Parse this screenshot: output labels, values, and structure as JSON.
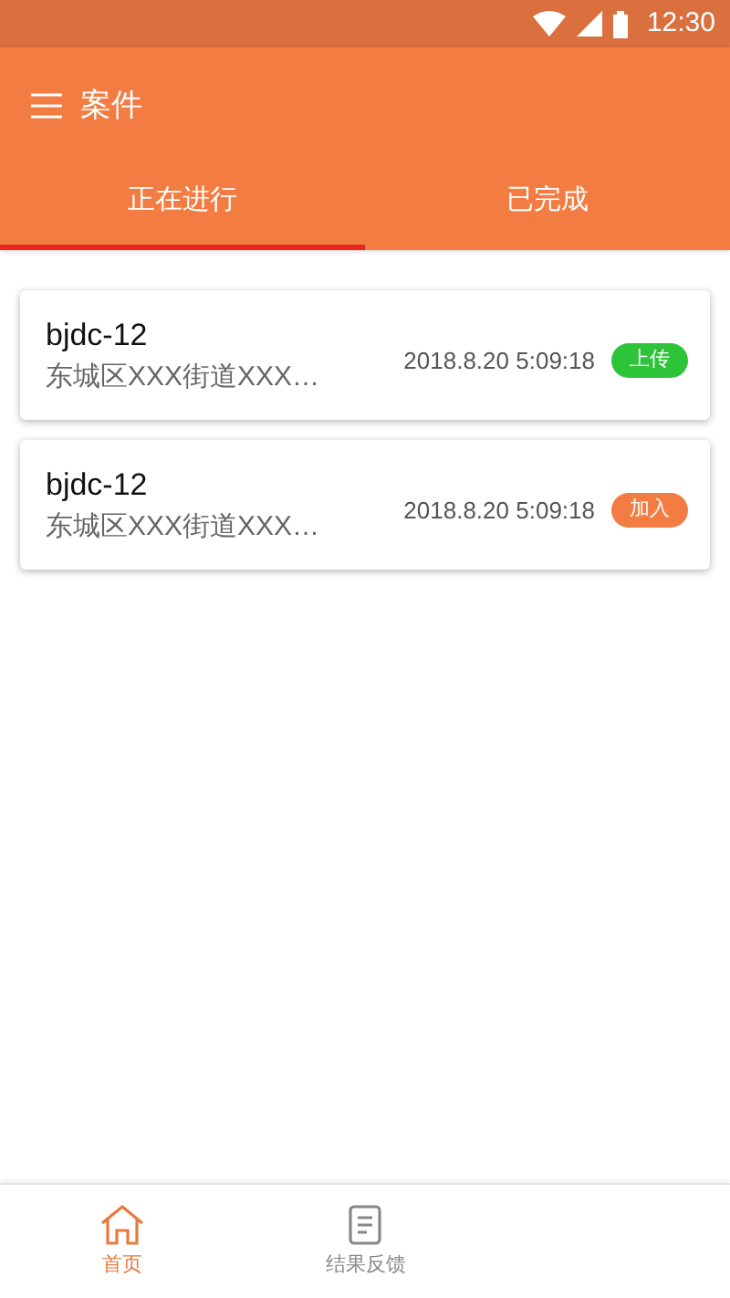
{
  "status_bar": {
    "time": "12:30"
  },
  "app_bar": {
    "title": "案件"
  },
  "tabs": [
    {
      "label": "正在进行",
      "selected": true
    },
    {
      "label": "已完成",
      "selected": false
    }
  ],
  "cases": [
    {
      "name": "bjdc-12",
      "address": "东城区XXX街道XXX…",
      "time": "2018.8.20 5:09:18",
      "action": "上传",
      "color": "#2ec43a"
    },
    {
      "name": "bjdc-12",
      "address": "东城区XXX街道XXX…",
      "time": "2018.8.20 5:09:18",
      "action": "加入",
      "color": "#f27c41"
    }
  ],
  "bottom_nav": [
    {
      "label": "首页",
      "selected": true,
      "kind": "home"
    },
    {
      "label": "结果反馈",
      "selected": false,
      "kind": "feedback"
    }
  ]
}
